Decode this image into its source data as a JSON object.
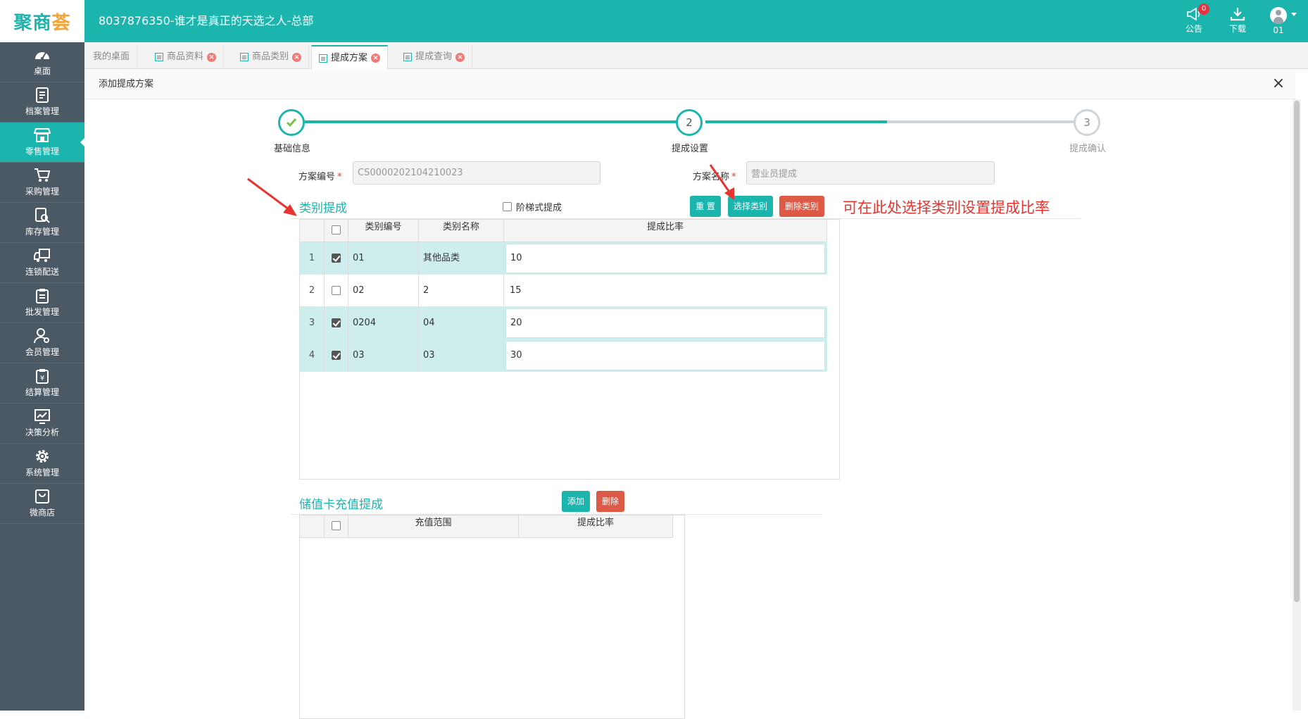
{
  "app": {
    "logo_main": "聚商",
    "logo_accent": "荟",
    "title": "8037876350-谁才是真正的天选之人-总部"
  },
  "header_tools": {
    "notice_label": "公告",
    "notice_badge": "0",
    "download_label": "下载",
    "user_label": "01"
  },
  "sidebar": {
    "items": [
      {
        "label": "桌面",
        "icon": "dashboard-icon"
      },
      {
        "label": "档案管理",
        "icon": "archive-icon"
      },
      {
        "label": "零售管理",
        "icon": "store-icon",
        "active": true
      },
      {
        "label": "采购管理",
        "icon": "cart-icon"
      },
      {
        "label": "库存管理",
        "icon": "inventory-icon"
      },
      {
        "label": "连锁配送",
        "icon": "truck-icon"
      },
      {
        "label": "批发管理",
        "icon": "wholesale-icon"
      },
      {
        "label": "会员管理",
        "icon": "member-icon"
      },
      {
        "label": "结算管理",
        "icon": "yen-icon"
      },
      {
        "label": "决策分析",
        "icon": "chart-icon"
      },
      {
        "label": "系统管理",
        "icon": "gear-icon"
      },
      {
        "label": "微商店",
        "icon": "shop-bag-icon"
      }
    ]
  },
  "tabs": [
    {
      "label": "我的桌面",
      "closable": false
    },
    {
      "label": "商品资料",
      "closable": true
    },
    {
      "label": "商品类别",
      "closable": true
    },
    {
      "label": "提成方案",
      "closable": true,
      "active": true
    },
    {
      "label": "提成查询",
      "closable": true
    }
  ],
  "panel": {
    "title": "添加提成方案",
    "close_glyph": "×"
  },
  "steps": [
    {
      "number": "1",
      "label": "基础信息",
      "state": "done"
    },
    {
      "number": "2",
      "label": "提成设置",
      "state": "current"
    },
    {
      "number": "3",
      "label": "提成确认",
      "state": "pending"
    }
  ],
  "form": {
    "plan_code_label": "方案编号",
    "plan_code_value": "CS0000202104210023",
    "plan_name_label": "方案名称",
    "plan_name_value": "营业员提成",
    "required_mark": "*"
  },
  "category_section": {
    "title": "类别提成",
    "tiered_label": "阶梯式提成",
    "reset_label": "重 置",
    "select_label": "选择类别",
    "delete_label": "删除类别",
    "annotation": "可在此处选择类别设置提成比率",
    "columns": [
      "类别编号",
      "类别名称",
      "提成比率"
    ],
    "rows": [
      {
        "index": "1",
        "checked": true,
        "code": "01",
        "name": "其他品类",
        "rate": "10"
      },
      {
        "index": "2",
        "checked": false,
        "code": "02",
        "name": "2",
        "rate": "15"
      },
      {
        "index": "3",
        "checked": true,
        "code": "0204",
        "name": "04",
        "rate": "20"
      },
      {
        "index": "4",
        "checked": true,
        "code": "03",
        "name": "03",
        "rate": "30"
      }
    ]
  },
  "card_section": {
    "title": "储值卡充值提成",
    "add_label": "添加",
    "delete_label": "删除",
    "columns": [
      "充值范围",
      "提成比率"
    ]
  },
  "colors": {
    "brand": "#1cb5ae",
    "sidebar": "#4a5964",
    "danger_button": "#dd5a46",
    "annotation": "#e8332f"
  }
}
